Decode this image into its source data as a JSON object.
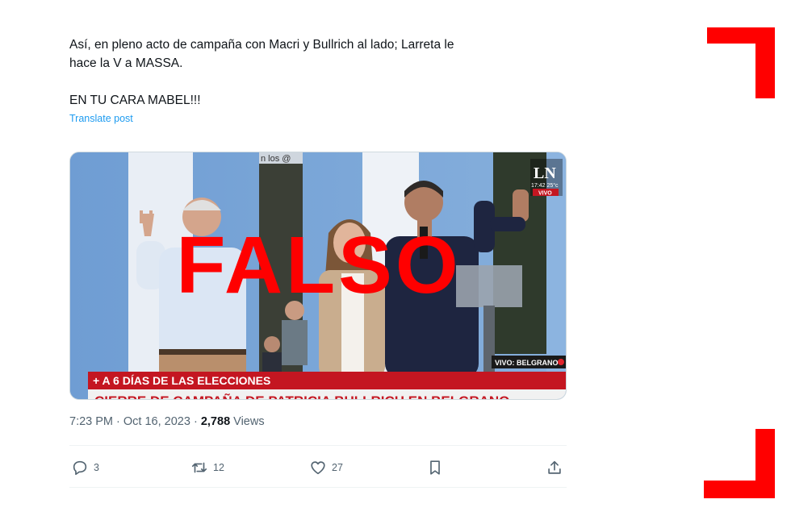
{
  "tweet": {
    "text_line1": "Así, en pleno acto de campaña con Macri y Bullrich al lado; Larreta le",
    "text_line2": "hace la V a MASSA.",
    "text_line3": "EN TU CARA MABEL!!!",
    "translate_label": "Translate post"
  },
  "media": {
    "stamp": "FALSO",
    "channel_logo": "LN",
    "clock": "17:42 25°c",
    "live_badge": "VIVO",
    "location": "VIVO: BELGRANO",
    "ticker_top": "+ A 6 DÍAS DE LAS ELECCIONES",
    "ticker_bottom": "CIERRE DE CAMPAÑA DE PATRICIA BULLRICH EN BELGRANO",
    "banner_fragment": "n los @",
    "colors": {
      "stamp": "#ff0000",
      "ticker": "#c41621"
    }
  },
  "meta": {
    "time": "7:23 PM",
    "date": "Oct 16, 2023",
    "dot": "·",
    "views_count": "2,788",
    "views_label": "Views"
  },
  "actions": {
    "replies": "3",
    "reposts": "12",
    "likes": "27"
  },
  "colors": {
    "accent": "#1d9bf0",
    "secondary_text": "#536471",
    "frame": "#ff0000"
  }
}
